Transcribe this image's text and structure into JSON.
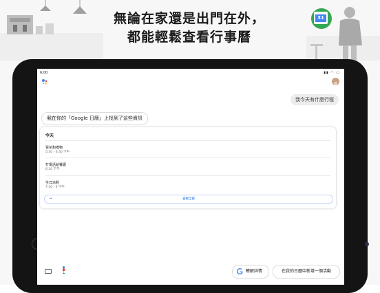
{
  "headline": {
    "line1": "無論在家還是出門在外，",
    "line2": "都能輕鬆查看行事曆"
  },
  "status_bar": {
    "time": "6:00",
    "icons": "▮▮ ◠ ▭"
  },
  "icons": {
    "assistant": "google-assistant-icon",
    "avatar": "user-avatar",
    "keyboard": "keyboard-icon",
    "mic": "microphone-icon",
    "google": "google-g-icon",
    "calendar": "calendar-icon"
  },
  "conversation": {
    "user_query": "我今天有什麼行程",
    "assistant_reply": "我在你的「Google 日曆」上找到了這些資訊"
  },
  "calendar_card": {
    "heading": "今天",
    "events": [
      {
        "title": "買花和禮物",
        "time": "5:30 - 6:30 下午"
      },
      {
        "title": "打電話給餐廳",
        "time": "6:30 下午"
      },
      {
        "title": "生日派對",
        "time": "7:30 - 9 下午"
      }
    ],
    "show_all": "查看全部"
  },
  "chips": {
    "learn_more": "瞭解詳情",
    "add_event": "在我的日曆中新增一個活動"
  },
  "calendar_badge": {
    "day": "31"
  },
  "colors": {
    "accent_blue": "#1a73e8",
    "google_green": "#34a853",
    "google_blue": "#4285f4"
  }
}
